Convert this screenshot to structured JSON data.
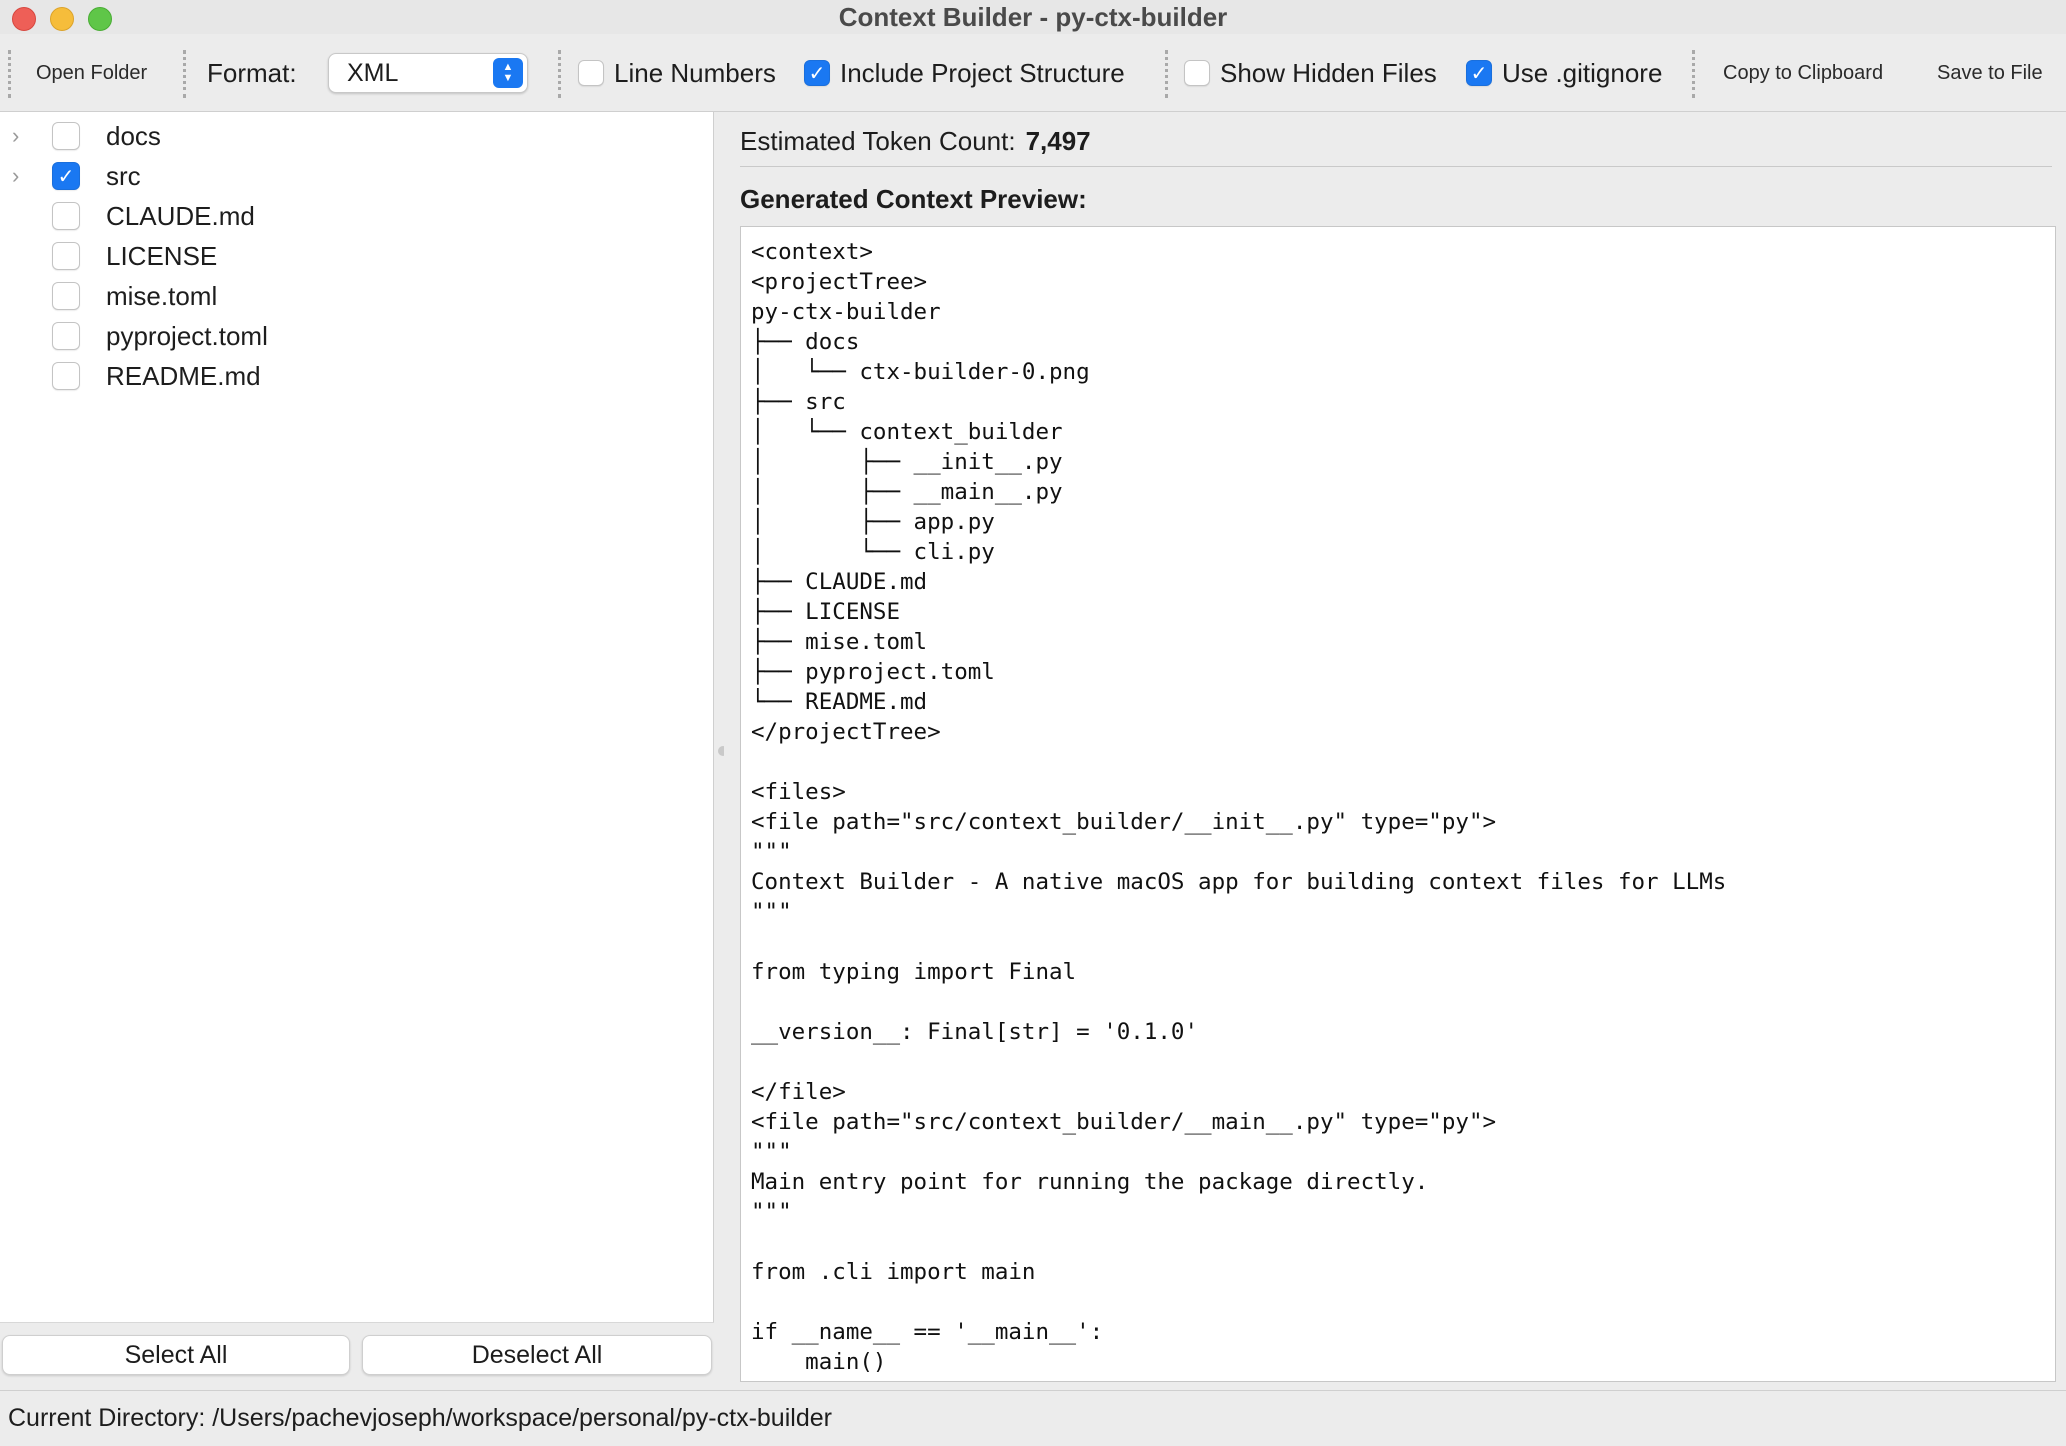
{
  "window": {
    "title": "Context Builder - py-ctx-builder"
  },
  "toolbar": {
    "open_folder": "Open Folder",
    "format_label": "Format:",
    "format_value": "XML",
    "line_numbers": {
      "label": "Line Numbers",
      "checked": false
    },
    "include_structure": {
      "label": "Include Project Structure",
      "checked": true
    },
    "show_hidden": {
      "label": "Show Hidden Files",
      "checked": false
    },
    "use_gitignore": {
      "label": "Use .gitignore",
      "checked": true
    },
    "copy": "Copy to Clipboard",
    "save": "Save to File"
  },
  "tree": [
    {
      "name": "docs",
      "expandable": true,
      "checked": false
    },
    {
      "name": "src",
      "expandable": true,
      "checked": true
    },
    {
      "name": "CLAUDE.md",
      "expandable": false,
      "checked": false
    },
    {
      "name": "LICENSE",
      "expandable": false,
      "checked": false
    },
    {
      "name": "mise.toml",
      "expandable": false,
      "checked": false
    },
    {
      "name": "pyproject.toml",
      "expandable": false,
      "checked": false
    },
    {
      "name": "README.md",
      "expandable": false,
      "checked": false
    }
  ],
  "buttons": {
    "select_all": "Select All",
    "deselect_all": "Deselect All"
  },
  "preview": {
    "token_label": "Estimated Token Count:",
    "token_count": "7,497",
    "title": "Generated Context Preview:",
    "lines": [
      "<context>",
      "<projectTree>",
      "py-ctx-builder",
      "├── docs",
      "│   └── ctx-builder-0.png",
      "├── src",
      "│   └── context_builder",
      "│       ├── __init__.py",
      "│       ├── __main__.py",
      "│       ├── app.py",
      "│       └── cli.py",
      "├── CLAUDE.md",
      "├── LICENSE",
      "├── mise.toml",
      "├── pyproject.toml",
      "└── README.md",
      "</projectTree>",
      "",
      "<files>",
      "<file path=\"src/context_builder/__init__.py\" type=\"py\">",
      "\"\"\"",
      "Context Builder - A native macOS app for building context files for LLMs",
      "\"\"\"",
      "",
      "from typing import Final",
      "",
      "__version__: Final[str] = '0.1.0'",
      "",
      "</file>",
      "<file path=\"src/context_builder/__main__.py\" type=\"py\">",
      "\"\"\"",
      "Main entry point for running the package directly.",
      "\"\"\"",
      "",
      "from .cli import main",
      "",
      "if __name__ == '__main__':",
      "    main()"
    ]
  },
  "status": {
    "text": "Current Directory: /Users/pachevjoseph/workspace/personal/py-ctx-builder"
  }
}
